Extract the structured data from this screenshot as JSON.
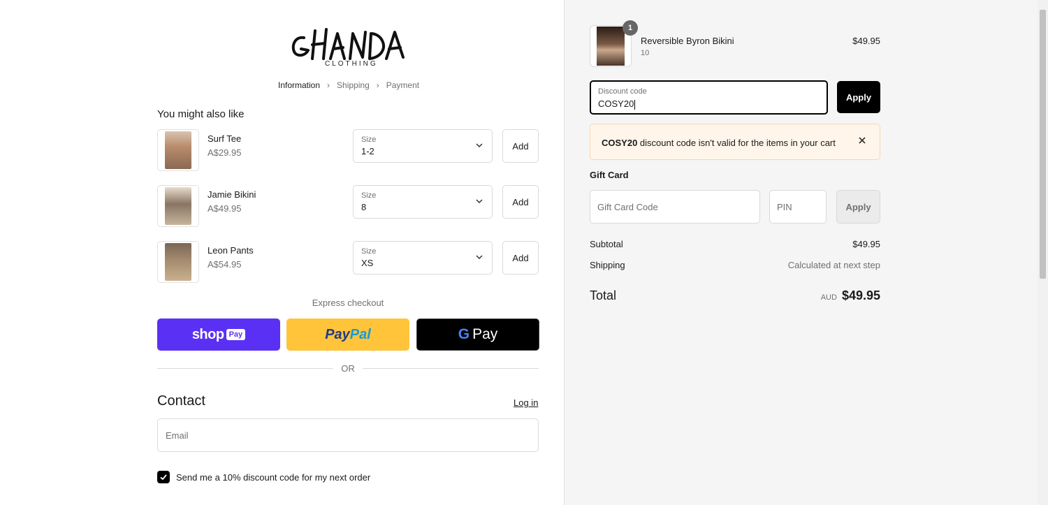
{
  "brand": {
    "logo_text": "GHANDA",
    "logo_subtext": "CLOTHING"
  },
  "breadcrumb": [
    {
      "label": "Information",
      "active": true
    },
    {
      "label": "Shipping",
      "active": false
    },
    {
      "label": "Payment",
      "active": false
    }
  ],
  "upsell": {
    "title": "You might also like",
    "items": [
      {
        "name": "Surf Tee",
        "price": "A$29.95",
        "size_label": "Size",
        "size_value": "1-2",
        "add_label": "Add",
        "image_color": "#b98c6d"
      },
      {
        "name": "Jamie Bikini",
        "price": "A$49.95",
        "size_label": "Size",
        "size_value": "8",
        "add_label": "Add",
        "image_color": "#8a7463"
      },
      {
        "name": "Leon Pants",
        "price": "A$54.95",
        "size_label": "Size",
        "size_value": "XS",
        "add_label": "Add",
        "image_color": "#a38b6f"
      }
    ]
  },
  "express": {
    "label": "Express checkout",
    "shop_pay": {
      "word": "shop",
      "badge": "Pay",
      "color": "#5a31f4"
    },
    "paypal": {
      "part1": "Pay",
      "part2": "Pal",
      "color": "#ffc439"
    },
    "gpay": {
      "g": "G",
      "word": "Pay"
    },
    "or_label": "OR"
  },
  "contact": {
    "title": "Contact",
    "login_label": "Log in",
    "email_placeholder": "Email",
    "newsletter_label": "Send me a 10% discount code for my next order",
    "newsletter_checked": true
  },
  "cart": {
    "item": {
      "name": "Reversible Byron Bikini",
      "variant": "10",
      "price": "$49.95",
      "quantity": "1"
    }
  },
  "discount": {
    "label": "Discount code",
    "value": "COSY20",
    "apply_label": "Apply",
    "error_code": "COSY20",
    "error_message": " discount code isn't valid for the items in your cart"
  },
  "gift_card": {
    "title": "Gift Card",
    "code_placeholder": "Gift Card Code",
    "pin_placeholder": "PIN",
    "apply_label": "Apply"
  },
  "summary": {
    "subtotal_label": "Subtotal",
    "subtotal_value": "$49.95",
    "shipping_label": "Shipping",
    "shipping_value": "Calculated at next step",
    "total_label": "Total",
    "currency": "AUD",
    "total_value": "$49.95"
  },
  "colors": {
    "accent": "#000000",
    "error_bg": "#fff5eb",
    "shop_pay": "#5a31f4",
    "paypal": "#ffc439"
  }
}
